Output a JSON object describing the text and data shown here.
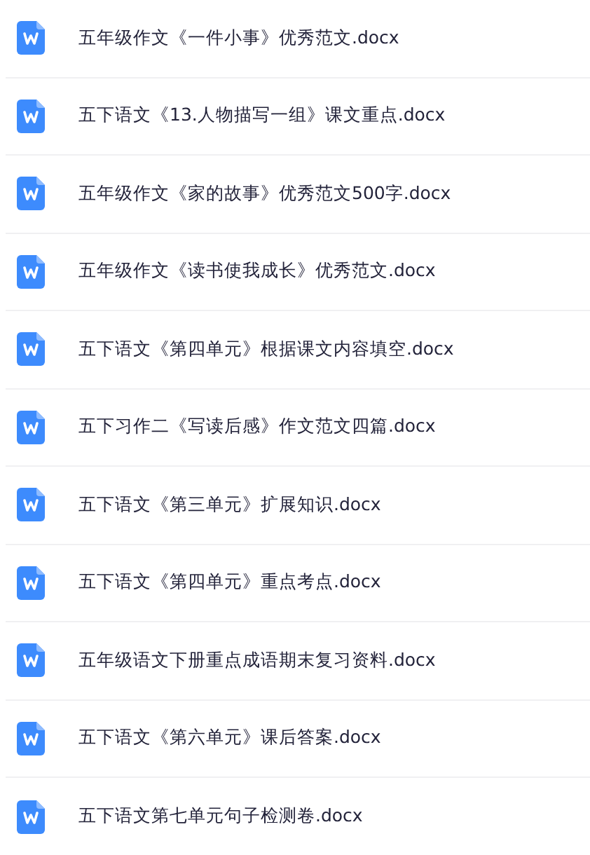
{
  "files": [
    {
      "name": "五年级作文《一件小事》优秀范文.docx"
    },
    {
      "name": "五下语文《13.人物描写一组》课文重点.docx"
    },
    {
      "name": "五年级作文《家的故事》优秀范文500字.docx"
    },
    {
      "name": "五年级作文《读书使我成长》优秀范文.docx"
    },
    {
      "name": "五下语文《第四单元》根据课文内容填空.docx"
    },
    {
      "name": "五下习作二《写读后感》作文范文四篇.docx"
    },
    {
      "name": "五下语文《第三单元》扩展知识.docx"
    },
    {
      "name": "五下语文《第四单元》重点考点.docx"
    },
    {
      "name": "五年级语文下册重点成语期末复习资料.docx"
    },
    {
      "name": "五下语文《第六单元》课后答案.docx"
    },
    {
      "name": "五下语文第七单元句子检测卷.docx"
    }
  ]
}
